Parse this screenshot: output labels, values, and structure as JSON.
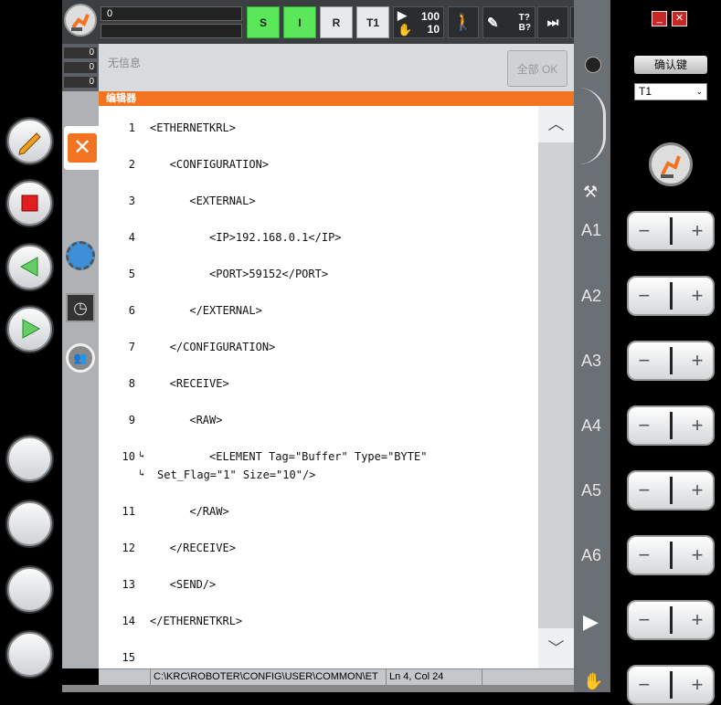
{
  "top": {
    "field_value": "0",
    "s_label": "S",
    "i_label": "I",
    "r_label": "R",
    "t1_label": "T1",
    "override_top": "100",
    "override_bottom": "10",
    "tq": "T?",
    "bq": "B?",
    "infinity": "∞"
  },
  "counters": [
    "0",
    "0",
    "0",
    "0"
  ],
  "messages": {
    "text": "无信息",
    "ack_all": "全部 OK"
  },
  "editor": {
    "title": "编辑器",
    "lines": [
      {
        "n": "1",
        "code": "<ETHERNETKRL>"
      },
      {
        "n": "2",
        "code": "   <CONFIGURATION>"
      },
      {
        "n": "3",
        "code": "      <EXTERNAL>"
      },
      {
        "n": "4",
        "code": "         <IP>192.168.0.1</IP>"
      },
      {
        "n": "5",
        "code": "         <PORT>59152</PORT>"
      },
      {
        "n": "6",
        "code": "      </EXTERNAL>"
      },
      {
        "n": "7",
        "code": "   </CONFIGURATION>"
      },
      {
        "n": "8",
        "code": "   <RECEIVE>"
      },
      {
        "n": "9",
        "code": "      <RAW>"
      },
      {
        "n": "10",
        "code": "         <ELEMENT Tag=\"Buffer\" Type=\"BYTE\""
      },
      {
        "n": "",
        "code": "Set_Flag=\"1\" Size=\"10\"/>"
      },
      {
        "n": "11",
        "code": "      </RAW>"
      },
      {
        "n": "12",
        "code": "   </RECEIVE>"
      },
      {
        "n": "13",
        "code": "   <SEND/>"
      },
      {
        "n": "14",
        "code": "</ETHERNETKRL>"
      },
      {
        "n": "15",
        "code": ""
      }
    ]
  },
  "status": {
    "path": "C:\\KRC\\ROBOTER\\CONFIG\\USER\\COMMON\\ET",
    "position": "Ln 4, Col 24"
  },
  "right": {
    "confirm": "确认键",
    "mode": "T1"
  },
  "axes": [
    "A1",
    "A2",
    "A3",
    "A4",
    "A5",
    "A6"
  ],
  "colors": {
    "accent": "#f27420",
    "green": "#5ae85a",
    "close_red": "#c62828"
  }
}
